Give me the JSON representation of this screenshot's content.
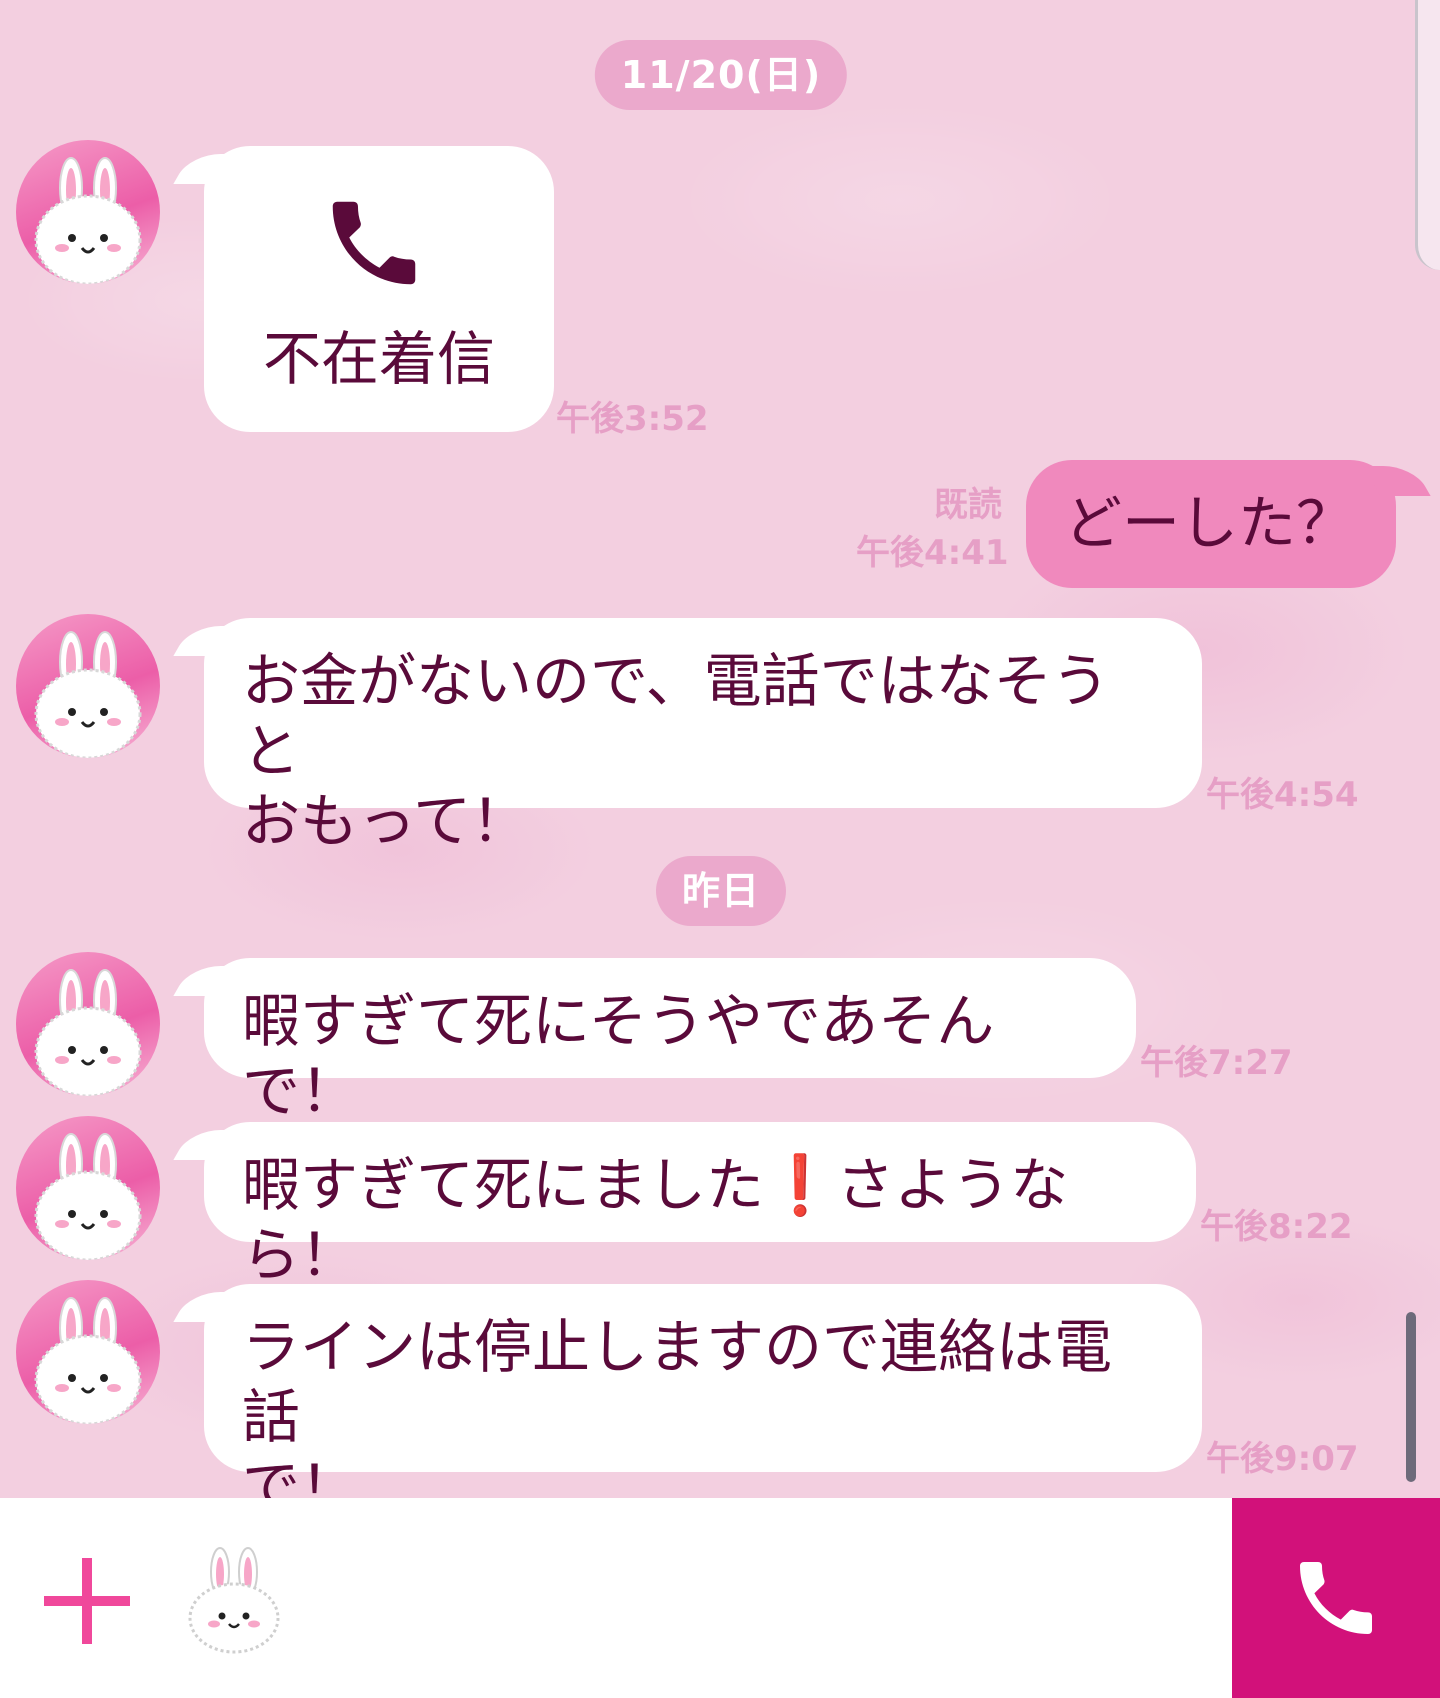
{
  "dates": {
    "first": "11/20(日)",
    "second": "昨日"
  },
  "messages": [
    {
      "kind": "missed_call",
      "text": "不在着信",
      "time": "午後3:52"
    },
    {
      "kind": "outgoing",
      "text": "どーした？",
      "read": "既読",
      "time": "午後4:41"
    },
    {
      "kind": "incoming",
      "line1": "お金がないので、電話ではなそうと",
      "line2": "おもって！",
      "time": "午後4:54"
    },
    {
      "kind": "incoming",
      "text": "暇すぎて死にそうやであそんで！",
      "time": "午後7:27"
    },
    {
      "kind": "incoming",
      "before": "暇すぎて死にました",
      "emoji": "❗",
      "after": "さようなら！",
      "time": "午後8:22"
    },
    {
      "kind": "incoming",
      "line1": "ラインは停止しますので連絡は電話",
      "line2": "で！",
      "time": "午後9:07"
    }
  ],
  "colors": {
    "background": "#f3cfe0",
    "incoming_bubble": "#ffffff",
    "outgoing_bubble": "#f089bd",
    "text": "#5a0a3a",
    "timestamp": "#e69fc6",
    "call_button": "#d2117a",
    "plus": "#f0489b"
  },
  "icons": {
    "avatar": "bunny-avatar-icon",
    "missed_call": "phone-icon",
    "add": "plus-icon",
    "sticker": "bunny-sticker-icon",
    "call": "phone-icon"
  }
}
